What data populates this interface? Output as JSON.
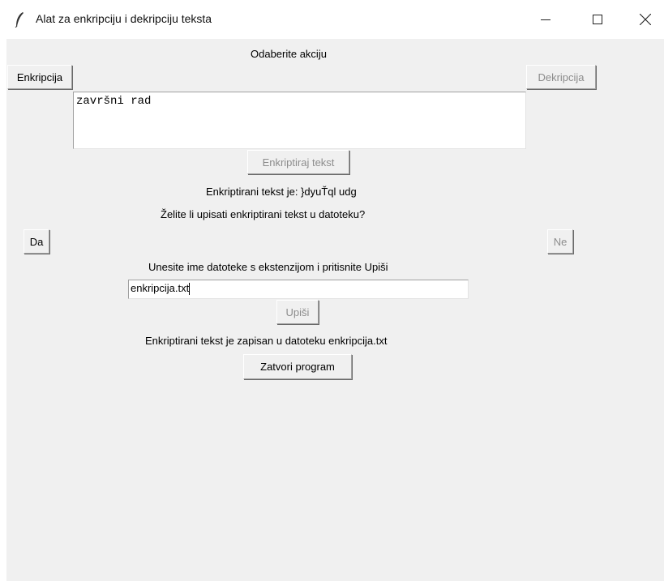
{
  "window": {
    "title": "Alat za enkripciju i dekripciju teksta",
    "minimize_icon": "minimize-icon",
    "maximize_icon": "maximize-icon",
    "close_icon": "close-icon"
  },
  "header": {
    "prompt": "Odaberite akciju"
  },
  "actions": {
    "encrypt_label": "Enkripcija",
    "decrypt_label": "Dekripcija"
  },
  "input": {
    "text": "završni rad"
  },
  "encrypt_button": {
    "label": "Enkriptiraj tekst",
    "disabled": true
  },
  "result": {
    "text": "Enkriptirani tekst je: }dyuŤql udg"
  },
  "save_question": {
    "text": "Želite li upisati enkriptirani tekst u datoteku?",
    "yes_label": "Da",
    "no_label": "Ne"
  },
  "filename": {
    "prompt": "Unesite ime datoteke s ekstenzijom i pritisnite Upiši",
    "value": "enkripcija.txt",
    "write_label": "Upiši"
  },
  "status": {
    "text": "Enkriptirani tekst je zapisan u datoteku enkripcija.txt"
  },
  "close_program": {
    "label": "Zatvori program"
  }
}
